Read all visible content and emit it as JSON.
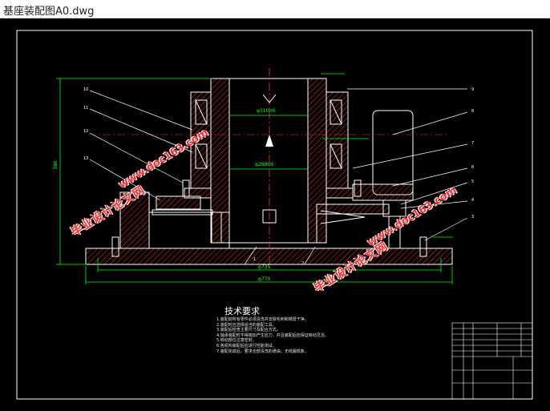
{
  "window": {
    "title": "基座装配图A0.dwg"
  },
  "drawing": {
    "dims": {
      "d310": "φ310H6",
      "d288": "φ288H6",
      "d735": "φ735",
      "d770": "φ770",
      "d380": "380"
    },
    "part_numbers": [
      "10",
      "11",
      "12",
      "13",
      "9",
      "8",
      "7",
      "6",
      "5",
      "4",
      "3",
      "1",
      "2"
    ],
    "notes_title": "技术要求",
    "notes": [
      "1.装配前所有零件必须清洗并去除毛刺和锈斑干净。",
      "2.装配时应选择适当的装配工具。",
      "3.装配后检查主要尺寸及配合方式。",
      "4.轴承装配时不得施加产生应力，并且装配后应保证转动灵活。",
      "5.转动部位注意密封，",
      "6.各机构装配后应进行性能测试。",
      "7.装配完成后，要求全部清洗的通油，无线漏现象。"
    ]
  },
  "watermarks": {
    "school": "毕业设计论文网",
    "url": "www.doc163.com"
  },
  "colors": {
    "background": "#000000",
    "outline": "#ffffff",
    "hatch": "#ff3030",
    "dimension": "#00ff00",
    "centerline": "#ff3030",
    "watermark": "#ff2a2a"
  }
}
